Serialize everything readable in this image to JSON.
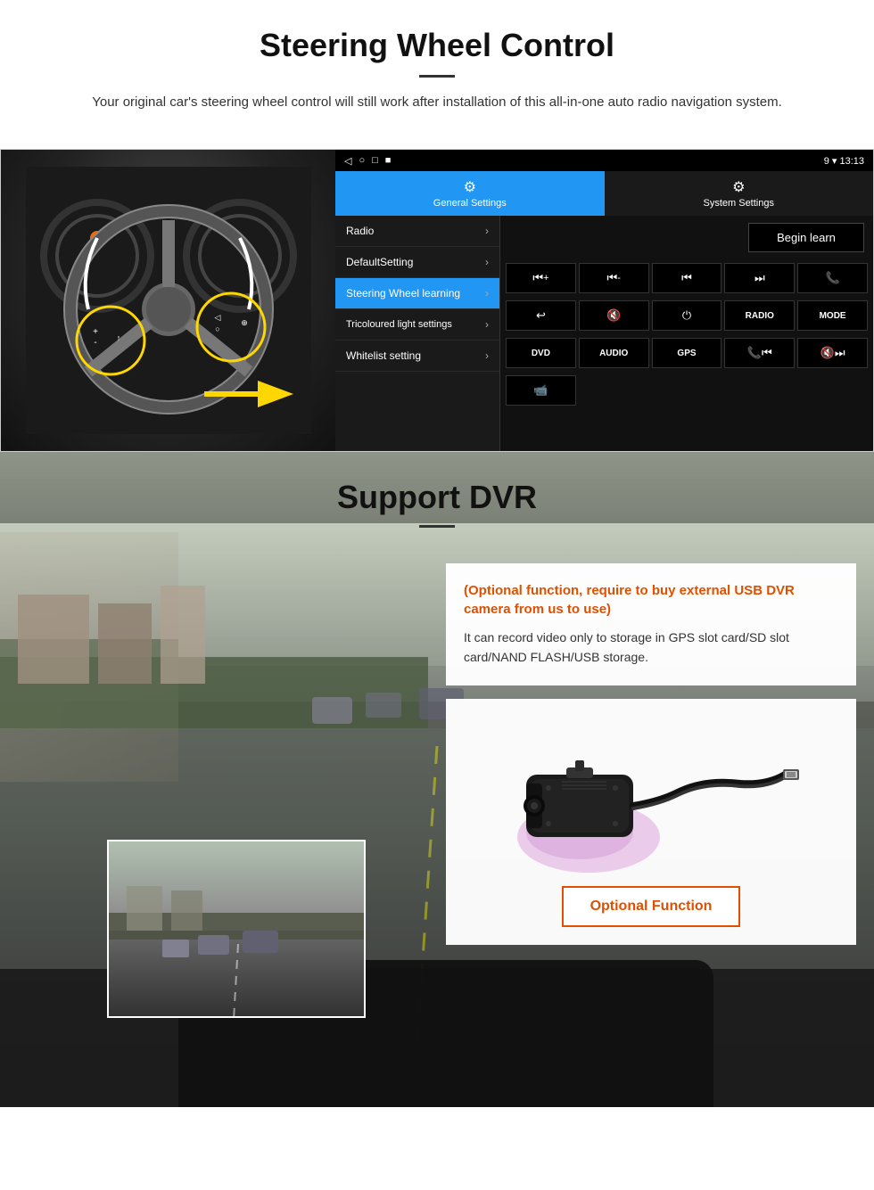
{
  "page": {
    "section1": {
      "title": "Steering Wheel Control",
      "description": "Your original car's steering wheel control will still work after installation of this all-in-one auto radio navigation system."
    },
    "android_ui": {
      "statusbar": {
        "nav": [
          "◁",
          "○",
          "□",
          "■"
        ],
        "status": "9 ▾ 13:13"
      },
      "tabs": [
        {
          "label": "General Settings",
          "icon": "⚙",
          "active": true
        },
        {
          "label": "System Settings",
          "icon": "⚙",
          "active": false
        }
      ],
      "menu_items": [
        {
          "label": "Radio",
          "active": false
        },
        {
          "label": "DefaultSetting",
          "active": false
        },
        {
          "label": "Steering Wheel learning",
          "active": true
        },
        {
          "label": "Tricoloured light settings",
          "active": false
        },
        {
          "label": "Whitelist setting",
          "active": false
        }
      ],
      "begin_learn": "Begin learn",
      "control_buttons_row1": [
        "⏮+",
        "⏮-",
        "⏮",
        "⏭",
        "📞"
      ],
      "control_buttons_row2": [
        "↩",
        "🔇",
        "⏻",
        "RADIO",
        "MODE"
      ],
      "control_buttons_row3": [
        "DVD",
        "AUDIO",
        "GPS",
        "📞⏮",
        "🔇⏭"
      ],
      "control_buttons_row4": [
        "📹"
      ]
    },
    "section2": {
      "title": "Support DVR",
      "optional_text": "(Optional function, require to buy external USB DVR camera from us to use)",
      "description": "It can record video only to storage in GPS slot card/SD slot card/NAND FLASH/USB storage.",
      "optional_button": "Optional Function"
    }
  }
}
